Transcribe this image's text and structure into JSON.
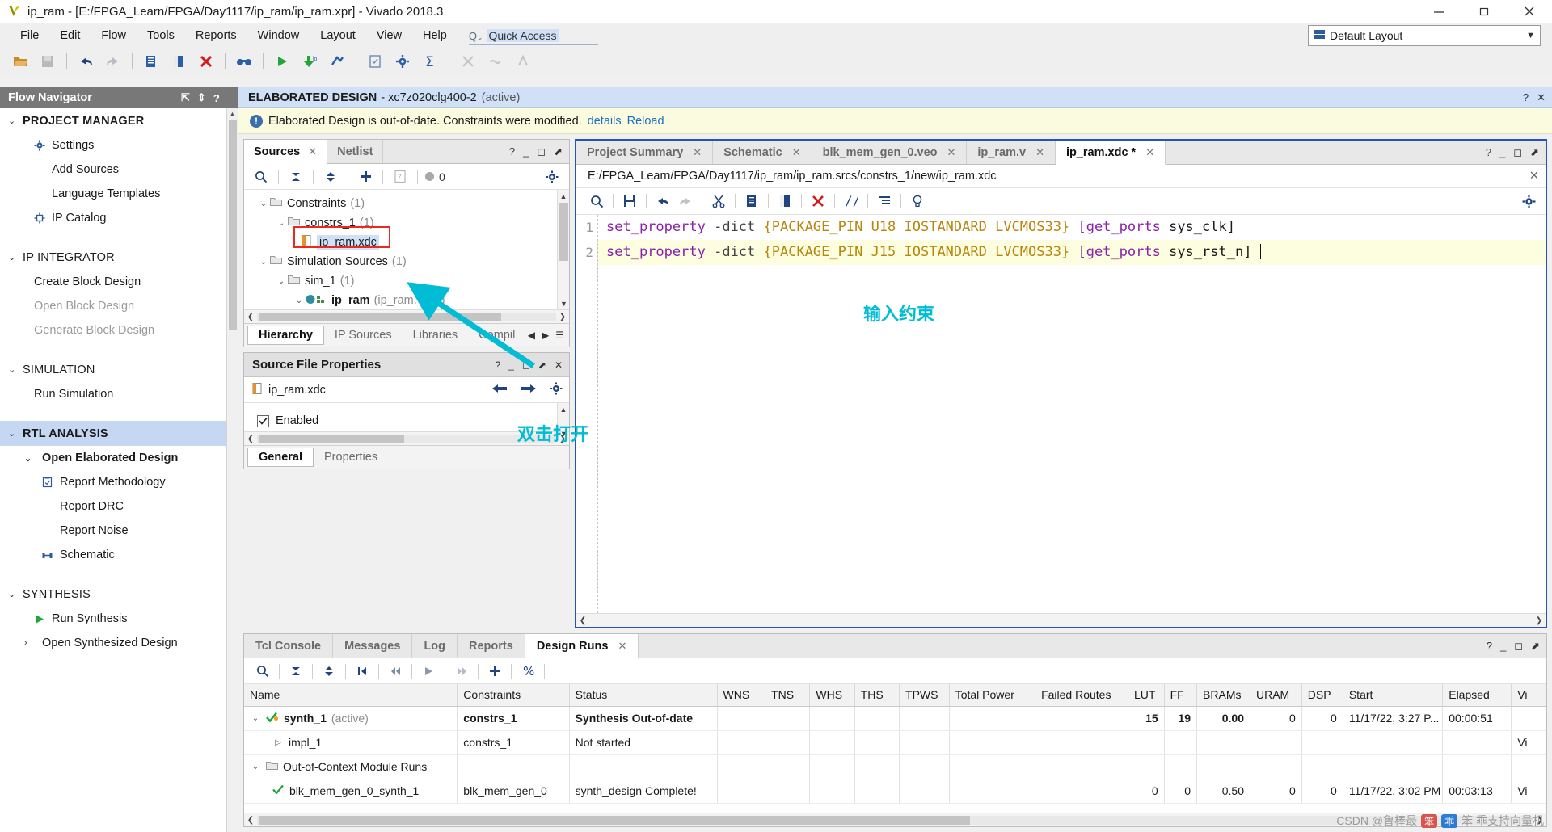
{
  "window": {
    "title": "ip_ram - [E:/FPGA_Learn/FPGA/Day1117/ip_ram/ip_ram.xpr] - Vivado 2018.3",
    "minimize": "minimize-icon",
    "maximize": "maximize-icon",
    "close": "close-icon"
  },
  "menubar": {
    "items": [
      "File",
      "Edit",
      "Flow",
      "Tools",
      "Reports",
      "Window",
      "Layout",
      "View",
      "Help"
    ],
    "quick_access_placeholder": "Quick Access",
    "status_text": "Synthesis Out-of-date",
    "details_link": "details",
    "layout_label": "Default Layout"
  },
  "flow_navigator": {
    "title": "Flow Navigator",
    "sections": [
      {
        "label": "PROJECT MANAGER",
        "bold": true,
        "items": [
          {
            "label": "Settings",
            "icon": "gear-icon"
          },
          {
            "label": "Add Sources",
            "icon": ""
          },
          {
            "label": "Language Templates",
            "icon": ""
          },
          {
            "label": "IP Catalog",
            "icon": "ip-icon"
          }
        ]
      },
      {
        "label": "IP INTEGRATOR",
        "bold": false,
        "items": [
          {
            "label": "Create Block Design",
            "icon": ""
          },
          {
            "label": "Open Block Design",
            "icon": "",
            "disabled": true
          },
          {
            "label": "Generate Block Design",
            "icon": "",
            "disabled": true
          }
        ]
      },
      {
        "label": "SIMULATION",
        "bold": false,
        "items": [
          {
            "label": "Run Simulation",
            "icon": ""
          }
        ]
      },
      {
        "label": "RTL ANALYSIS",
        "bold": true,
        "selected": true,
        "items": [
          {
            "label": "Open Elaborated Design",
            "icon": "chevron-down-icon",
            "bold": true
          },
          {
            "label": "Report Methodology",
            "icon": "clipboard-icon",
            "sub": true
          },
          {
            "label": "Report DRC",
            "icon": "",
            "sub": true
          },
          {
            "label": "Report Noise",
            "icon": "",
            "sub": true
          },
          {
            "label": "Schematic",
            "icon": "schematic-icon",
            "sub": true
          }
        ]
      },
      {
        "label": "SYNTHESIS",
        "bold": false,
        "items": [
          {
            "label": "Run Synthesis",
            "icon": "run-icon"
          },
          {
            "label": "Open Synthesized Design",
            "icon": "chevron-right-icon"
          }
        ]
      }
    ]
  },
  "design_header": {
    "title": "ELABORATED DESIGN",
    "device": "- xc7z020clg400-2",
    "active": "(active)"
  },
  "warning_bar": {
    "text": "Elaborated Design is out-of-date. Constraints were modified.",
    "details": "details",
    "reload": "Reload"
  },
  "sources_panel": {
    "tabs": [
      {
        "label": "Sources",
        "active": true,
        "closable": true
      },
      {
        "label": "Netlist",
        "active": false,
        "closable": false
      }
    ],
    "toolbar_badge": "0",
    "tree": [
      {
        "label": "Constraints",
        "count": "(1)",
        "indent": 0,
        "type": "folder",
        "expanded": true
      },
      {
        "label": "constrs_1",
        "count": "(1)",
        "indent": 1,
        "type": "folder",
        "expanded": true
      },
      {
        "label": "ip_ram.xdc",
        "count": "",
        "indent": 2,
        "type": "file",
        "selected": true,
        "highlighted": true
      },
      {
        "label": "Simulation Sources",
        "count": "(1)",
        "indent": 0,
        "type": "folder",
        "expanded": true
      },
      {
        "label": "sim_1",
        "count": "(1)",
        "indent": 1,
        "type": "folder",
        "expanded": true
      },
      {
        "label": "ip_ram",
        "count": "(2)",
        "file": "(ip_ram.v)",
        "indent": 2,
        "type": "module",
        "expanded": true,
        "bold": true
      }
    ],
    "subtabs": [
      {
        "label": "Hierarchy",
        "active": true
      },
      {
        "label": "IP Sources",
        "active": false
      },
      {
        "label": "Libraries",
        "active": false
      },
      {
        "label": "Compil",
        "active": false
      }
    ]
  },
  "properties_panel": {
    "title": "Source File Properties",
    "file_name": "ip_ram.xdc",
    "enabled_label": "Enabled",
    "enabled_checked": true,
    "tabs": [
      {
        "label": "General",
        "active": true
      },
      {
        "label": "Properties",
        "active": false
      }
    ]
  },
  "editor": {
    "tabs": [
      {
        "label": "Project Summary",
        "active": false,
        "closable": true
      },
      {
        "label": "Schematic",
        "active": false,
        "closable": true
      },
      {
        "label": "blk_mem_gen_0.veo",
        "active": false,
        "closable": true
      },
      {
        "label": "ip_ram.v",
        "active": false,
        "closable": true
      },
      {
        "label": "ip_ram.xdc *",
        "active": true,
        "closable": true
      }
    ],
    "file_path": "E:/FPGA_Learn/FPGA/Day1117/ip_ram/ip_ram.srcs/constrs_1/new/ip_ram.xdc",
    "lines": [
      {
        "number": "1",
        "current": false,
        "cmd": "set_property",
        "opt": "-dict",
        "dict": "{PACKAGE_PIN U18 IOSTANDARD LVCMOS33}",
        "getports": "[get_ports",
        "port": "sys_clk]"
      },
      {
        "number": "2",
        "current": true,
        "cmd": "set_property",
        "opt": "-dict",
        "dict": "{PACKAGE_PIN J15 IOSTANDARD LVCMOS33}",
        "getports": "[get_ports",
        "port": "sys_rst_n]"
      }
    ]
  },
  "annotations": {
    "double_click_open": "双击打开",
    "input_constraint": "输入约束",
    "color_cyan": "#00bcd4",
    "color_red": "#ea2a1f"
  },
  "bottom_dock": {
    "tabs": [
      {
        "label": "Tcl Console",
        "active": false,
        "closable": false
      },
      {
        "label": "Messages",
        "active": false,
        "closable": false
      },
      {
        "label": "Log",
        "active": false,
        "closable": false
      },
      {
        "label": "Reports",
        "active": false,
        "closable": false
      },
      {
        "label": "Design Runs",
        "active": true,
        "closable": true
      }
    ],
    "columns": [
      "Name",
      "Constraints",
      "Status",
      "WNS",
      "TNS",
      "WHS",
      "THS",
      "TPWS",
      "Total Power",
      "Failed Routes",
      "LUT",
      "FF",
      "BRAMs",
      "URAM",
      "DSP",
      "Start",
      "Elapsed",
      "Vi"
    ],
    "rows": [
      {
        "indent": 0,
        "expander": "chevron-down-icon",
        "status_icon": "check-orange-icon",
        "name": "synth_1",
        "name_suffix": "(active)",
        "bold": true,
        "constraints": "constrs_1",
        "status": "Synthesis Out-of-date",
        "wns": "",
        "tns": "",
        "whs": "",
        "ths": "",
        "tpws": "",
        "total_power": "",
        "failed_routes": "",
        "lut": "15",
        "ff": "19",
        "brams": "0.00",
        "uram": "0",
        "dsp": "0",
        "start": "11/17/22, 3:27 P...",
        "elapsed": "00:00:51",
        "vi": ""
      },
      {
        "indent": 1,
        "expander": "chevron-right-icon",
        "status_icon": "",
        "name": "impl_1",
        "name_suffix": "",
        "bold": false,
        "constraints": "constrs_1",
        "status": "Not started",
        "wns": "",
        "tns": "",
        "whs": "",
        "ths": "",
        "tpws": "",
        "total_power": "",
        "failed_routes": "",
        "lut": "",
        "ff": "",
        "brams": "",
        "uram": "",
        "dsp": "",
        "start": "",
        "elapsed": "",
        "vi": "Vi"
      },
      {
        "indent": 0,
        "expander": "chevron-down-icon",
        "status_icon": "folder-icon",
        "name": "Out-of-Context Module Runs",
        "name_suffix": "",
        "bold": false,
        "constraints": "",
        "status": "",
        "wns": "",
        "tns": "",
        "whs": "",
        "ths": "",
        "tpws": "",
        "total_power": "",
        "failed_routes": "",
        "lut": "",
        "ff": "",
        "brams": "",
        "uram": "",
        "dsp": "",
        "start": "",
        "elapsed": "",
        "vi": ""
      },
      {
        "indent": 1,
        "expander": "",
        "status_icon": "check-green-icon",
        "name": "blk_mem_gen_0_synth_1",
        "name_suffix": "",
        "bold": false,
        "constraints": "blk_mem_gen_0",
        "status": "synth_design Complete!",
        "wns": "",
        "tns": "",
        "whs": "",
        "ths": "",
        "tpws": "",
        "total_power": "",
        "failed_routes": "",
        "lut": "0",
        "ff": "0",
        "brams": "0.50",
        "uram": "0",
        "dsp": "0",
        "start": "11/17/22, 3:02 PM",
        "elapsed": "00:03:13",
        "vi": "Vi"
      }
    ]
  },
  "watermark": {
    "prefix": "CSDN @鲁棒最",
    "suffix": "笨 乖支持向量机"
  }
}
